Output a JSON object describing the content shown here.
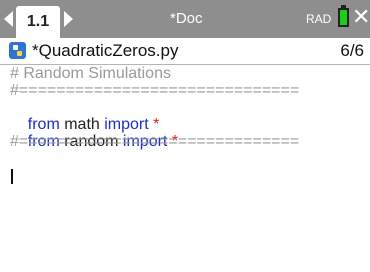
{
  "topbar": {
    "tab_label": "1.1",
    "doc_title": "*Doc",
    "mode": "RAD",
    "battery_color": "#1bd01b",
    "close_icon": "close-icon"
  },
  "file": {
    "icon": "python-file-icon",
    "name": "*QuadraticZeros.py",
    "line_info": "6/6"
  },
  "code": {
    "line1": "# Random Simulations",
    "line2": "#==============================",
    "line3": {
      "kw1": "from",
      "mod": " math ",
      "kw2": "import",
      "star": " *"
    },
    "line4": {
      "kw1": "from",
      "mod": " random ",
      "kw2": "import",
      "star": " *"
    },
    "line5": "#==============================",
    "line6": ""
  }
}
